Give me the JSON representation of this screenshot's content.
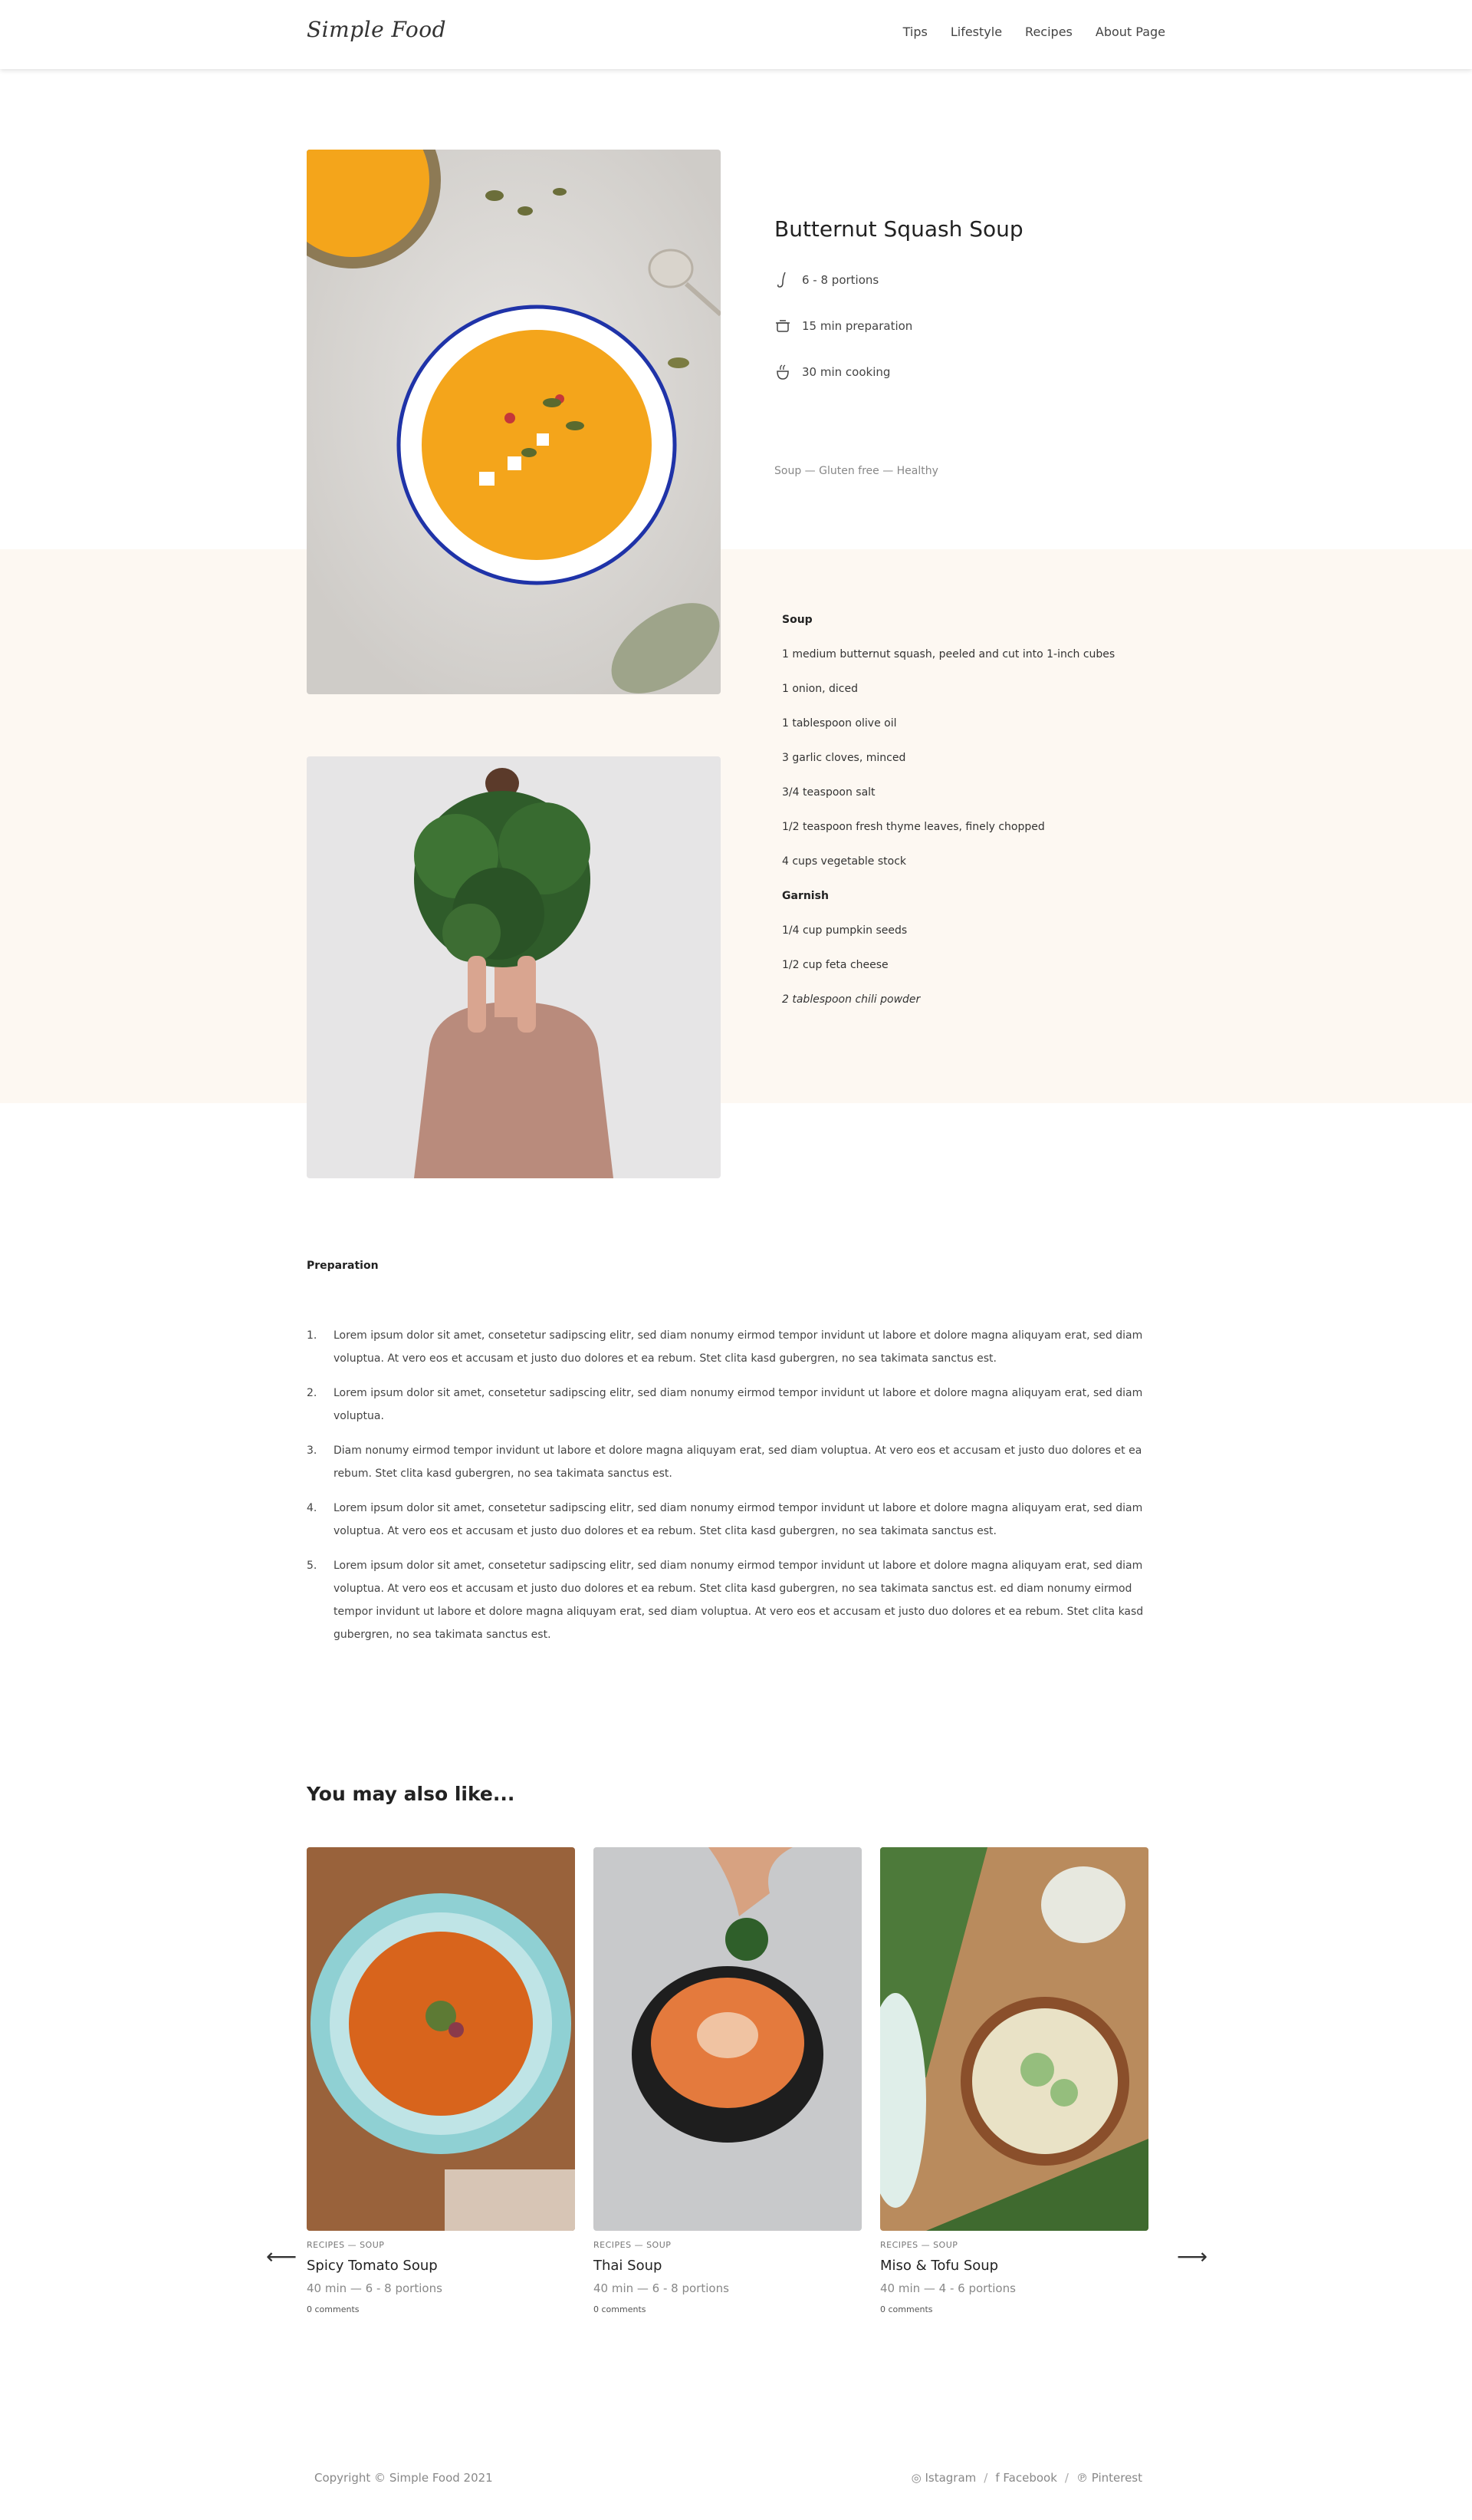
{
  "header": {
    "logo": "Simple Food",
    "nav": [
      "Tips",
      "Lifestyle",
      "Recipes",
      "About Page"
    ]
  },
  "recipe": {
    "title": "Butternut Squash Soup",
    "portions": "6 - 8 portions",
    "preparation": "15 min preparation",
    "cooking": "30 min cooking",
    "tags": "Soup — Gluten free — Healthy"
  },
  "ingredients": [
    {
      "text": "Soup",
      "style": "head"
    },
    {
      "text": "1 medium butternut squash, peeled and cut into 1-inch cubes"
    },
    {
      "text": "1 onion, diced"
    },
    {
      "text": "1 tablespoon olive oil"
    },
    {
      "text": "3 garlic cloves, minced"
    },
    {
      "text": "3/4 teaspoon salt"
    },
    {
      "text": "1/2 teaspoon fresh thyme leaves, finely chopped"
    },
    {
      "text": "4 cups vegetable stock"
    },
    {
      "text": "Garnish",
      "style": "head"
    },
    {
      "text": "1/4 cup pumpkin seeds"
    },
    {
      "text": "1/2 cup feta cheese"
    },
    {
      "text": "2 tablespoon chili powder",
      "style": "em"
    }
  ],
  "preparation": {
    "heading": "Preparation",
    "steps": [
      {
        "num": "1.",
        "text": "Lorem ipsum dolor sit amet, consetetur sadipscing elitr, sed diam nonumy eirmod tempor invidunt ut labore et dolore magna aliquyam erat, sed diam voluptua. At vero eos et accusam et   justo duo dolores et ea rebum. Stet clita kasd gubergren, no sea takimata sanctus est."
      },
      {
        "num": "2.",
        "text": "Lorem ipsum dolor sit amet, consetetur sadipscing elitr, sed diam nonumy eirmod tempor invidunt ut labore et dolore magna aliquyam erat, sed diam voluptua."
      },
      {
        "num": "3.",
        "text": "Diam nonumy eirmod tempor invidunt ut labore et dolore magna aliquyam erat, sed diam voluptua. At vero eos et accusam et justo duo dolores et ea rebum. Stet clita kasd gubergren, no sea takimata sanctus est."
      },
      {
        "num": "4.",
        "text": "Lorem ipsum dolor sit amet, consetetur sadipscing elitr, sed diam nonumy eirmod tempor invidunt ut labore et dolore magna aliquyam erat, sed diam voluptua. At vero eos et accusam et justo duo dolores et ea rebum. Stet clita kasd gubergren, no sea takimata sanctus est."
      },
      {
        "num": "5.",
        "text": "Lorem ipsum dolor sit amet, consetetur sadipscing elitr, sed diam nonumy eirmod tempor invidunt ut labore et dolore magna aliquyam erat, sed diam voluptua. At vero eos et accusam et justo duo dolores et ea rebum. Stet clita kasd gubergren, no sea takimata sanctus est. ed diam nonumy eirmod tempor invidunt ut labore et dolore magna aliquyam erat, sed diam voluptua. At vero eos et accusam et justo duo dolores et ea rebum. Stet clita kasd gubergren, no sea takimata sanctus est."
      }
    ]
  },
  "related": {
    "heading": "You may also like...",
    "cards": [
      {
        "kicker": "RECIPES — SOUP",
        "title": "Spicy Tomato Soup",
        "meta": "40 min — 6 - 8 portions",
        "comments": "0 comments"
      },
      {
        "kicker": "RECIPES — SOUP",
        "title": "Thai Soup",
        "meta": "40 min — 6 - 8 portions",
        "comments": "0 comments"
      },
      {
        "kicker": "RECIPES — SOUP",
        "title": "Miso & Tofu Soup",
        "meta": "40 min — 4 - 6 portions",
        "comments": "0 comments"
      }
    ],
    "prev_arrow": "⟵",
    "next_arrow": "⟶"
  },
  "footer": {
    "copyright": "Copyright © Simple Food 2021",
    "social": [
      "Istagram",
      "Facebook",
      "Pinterest"
    ],
    "separator": "/"
  },
  "colors": {
    "cream_band": "#fdf8f2",
    "soup_orange": "#f5a623",
    "text_dark": "#222222"
  }
}
